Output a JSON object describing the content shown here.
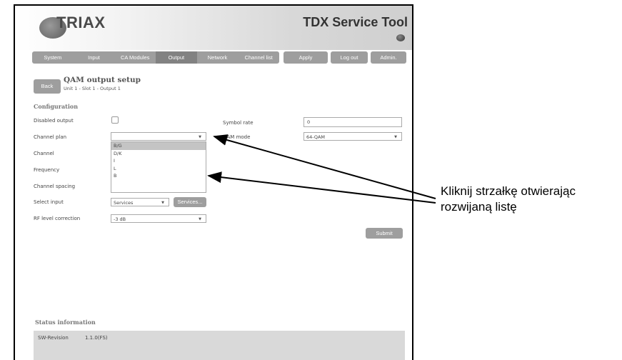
{
  "header": {
    "logo": "TRIAX",
    "title": "TDX Service Tool"
  },
  "nav": {
    "tabs": [
      "System",
      "Input",
      "CA Modules",
      "Output",
      "Network",
      "Channel list"
    ],
    "active": "Output",
    "apply": "Apply",
    "logout": "Log out",
    "admin": "Admin."
  },
  "page": {
    "back": "Back",
    "title": "QAM  output setup",
    "subtitle": "Unit 1 - Slot 1 - Output 1"
  },
  "config": {
    "heading": "Configuration",
    "disabled_output": "Disabled output",
    "channel_plan": "Channel plan",
    "channel": "Channel",
    "frequency": "Frequency",
    "channel_spacing": "Channel spacing",
    "select_input": "Select input",
    "select_input_value": "Services",
    "services_button": "Services...",
    "rf_level": "RF level correction",
    "rf_level_value": "-3 dB",
    "symbol_rate": "Symbol rate",
    "symbol_rate_value": "0",
    "qam_mode": "QAM mode",
    "qam_mode_value": "64-QAM",
    "submit": "Submit",
    "channel_plan_value": "",
    "channel_plan_options": [
      "B/G",
      "D/K",
      "I",
      "L",
      "B"
    ],
    "channel_plan_highlighted": "B/G"
  },
  "status": {
    "heading": "Status information",
    "sw_label": "SW-Revision",
    "sw_value": "1.1.0(FS)"
  },
  "annotation": {
    "line1": "Kliknij strzałkę otwierając",
    "line2": "rozwijaną listę"
  },
  "colors": {
    "nav": "#9e9e9e",
    "nav_active": "#828282",
    "status_bg": "#d9d9d9",
    "highlight": "#c4c4c4"
  },
  "icons": {
    "dropdown_arrow": "▼",
    "status_led": "led-icon"
  }
}
